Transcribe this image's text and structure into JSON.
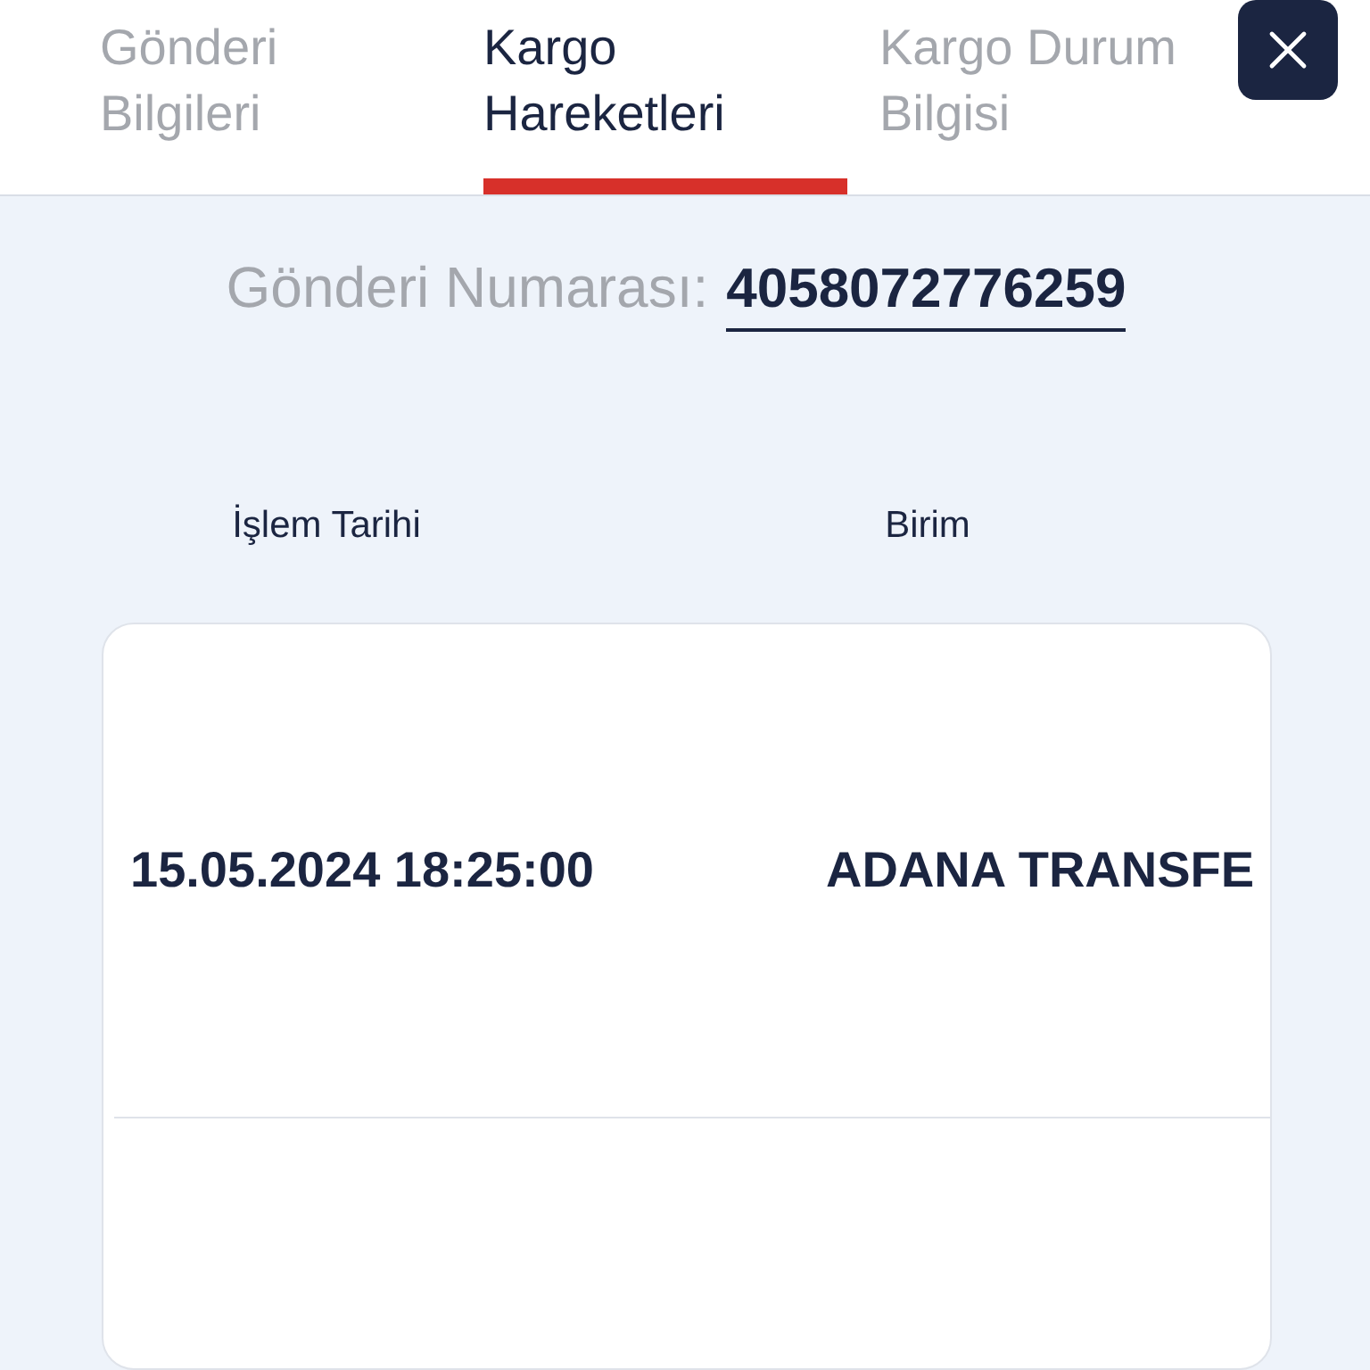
{
  "tabs": [
    {
      "label": "Gönderi Bilgileri",
      "selected": false
    },
    {
      "label": "Kargo Hareketleri",
      "selected": true
    },
    {
      "label": "Kargo Durum Bilgisi",
      "selected": false
    }
  ],
  "close_button": {
    "kind": "icon"
  },
  "shipment": {
    "label": "Gönderi Numarası:",
    "number": "4058072776259"
  },
  "table": {
    "columns": [
      "İşlem Tarihi",
      "Birim"
    ],
    "rows": [
      [
        "15.05.2024 18:25:00",
        "ADANA TRANSFE"
      ],
      []
    ]
  }
}
